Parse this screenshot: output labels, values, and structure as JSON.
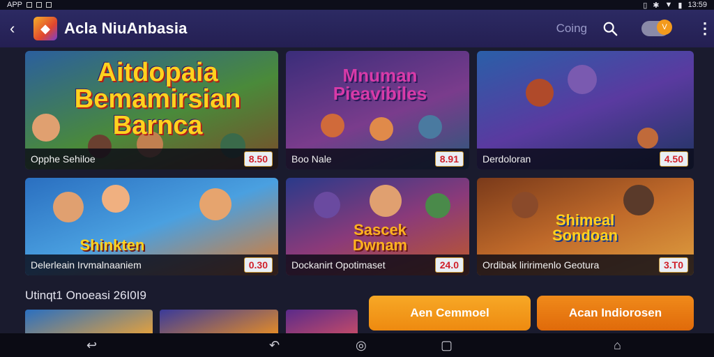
{
  "status_bar": {
    "app_label": "APP",
    "time": "13:59"
  },
  "app_bar": {
    "title": "Acla NiuAnbasia",
    "coin_label": "Coing",
    "toggle_badge": "V"
  },
  "cards": [
    {
      "banner": "Aitdopaia Bemamirsian Barnca",
      "name": "Opphe Sehiloe",
      "price": "8.50",
      "colors": [
        "#2b5f9e",
        "#4a8a3a",
        "#7a4a2a"
      ]
    },
    {
      "banner": "Mnuman Pieavibiles",
      "name": "Boo Nale",
      "price": "8.91",
      "colors": [
        "#3a2d7a",
        "#7a3c8c",
        "#2a5a7a"
      ]
    },
    {
      "banner": "",
      "name": "Derdoloran",
      "price": "4.50",
      "colors": [
        "#2a5fa8",
        "#5a3aa0",
        "#1e3560"
      ]
    },
    {
      "banner": "Shinkten",
      "name": "Delerleain Irvmalnaaniem",
      "price": "0.30",
      "colors": [
        "#2a6fc0",
        "#4aa0e0",
        "#e07a2a"
      ]
    },
    {
      "banner": "Sascek Dwnam",
      "name": "Dockanirt Opotimaset",
      "price": "24.0",
      "colors": [
        "#2a3a8a",
        "#8a3a7a",
        "#c05a2a"
      ]
    },
    {
      "banner": "Shimeal Sondoan",
      "name": "Ordibak liririmenlo Geotura",
      "price": "3.T0",
      "colors": [
        "#7a3a1a",
        "#c06a2a",
        "#e0a040"
      ]
    }
  ],
  "section": {
    "title": "Utinqt1 Onoeasi 26I0I9"
  },
  "buttons": {
    "primary": "Aen Cemmoel",
    "secondary": "Acan Indiorosen"
  },
  "colors": {
    "accent": "#f39a1c",
    "app_bar": "#2c2a63",
    "background": "#1a1b2e",
    "price_text": "#d0202a"
  }
}
